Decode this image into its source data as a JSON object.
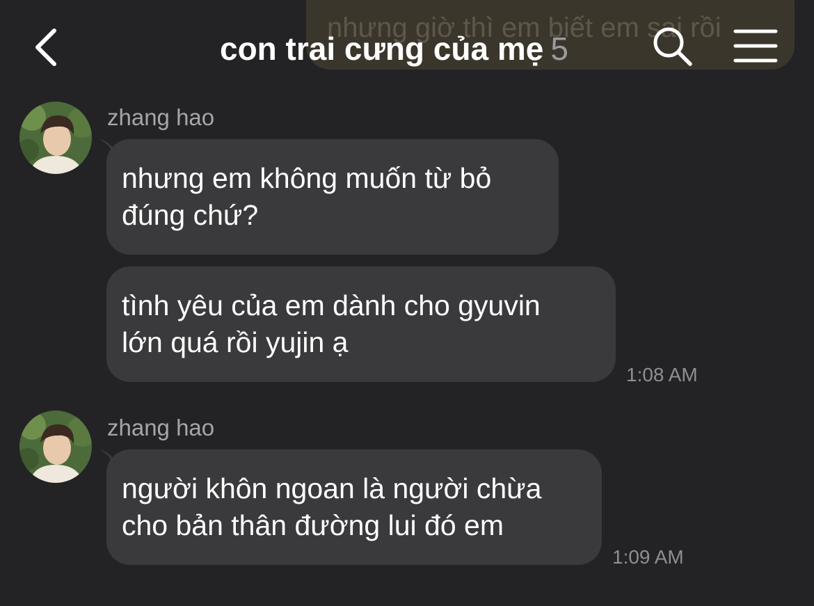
{
  "header": {
    "title": "con trai cưng của mẹ",
    "member_count": "5",
    "back_icon": "chevron-left-icon",
    "search_icon": "search-icon",
    "menu_icon": "hamburger-menu-icon"
  },
  "previous_message": {
    "text": "nhưng giờ thì em biết em sai rồi"
  },
  "groups": [
    {
      "sender": "zhang hao",
      "messages": [
        {
          "text": "nhưng em không muốn từ bỏ\nđúng chứ?"
        },
        {
          "text": "tình yêu của em dành cho gyuvin\nlớn quá rồi yujin ạ"
        }
      ],
      "time": "1:08 AM"
    },
    {
      "sender": "zhang hao",
      "messages": [
        {
          "text": "người khôn ngoan là người chừa\ncho bản thân đường lui đó em"
        }
      ],
      "time": "1:09 AM"
    }
  ],
  "colors": {
    "background": "#232325",
    "bubble": "#3a3a3c",
    "outgoing_bubble": "#3b362c",
    "secondary_text": "#a6a6aa"
  }
}
